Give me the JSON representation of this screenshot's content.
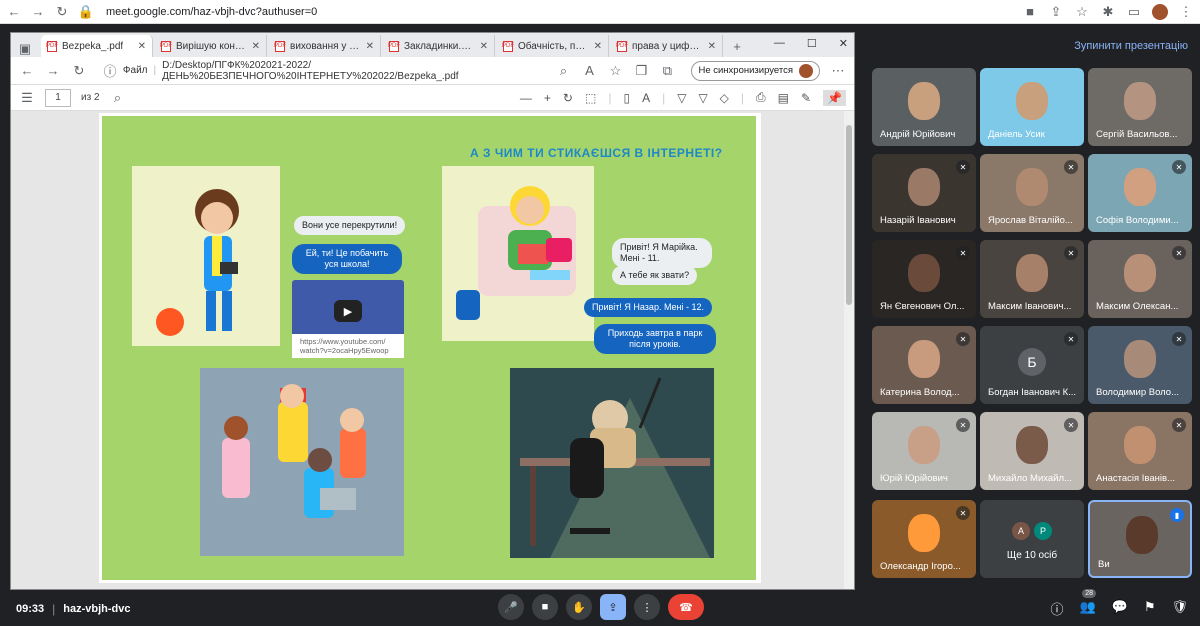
{
  "chrome": {
    "url": "meet.google.com/haz-vbjh-dvc?authuser=0"
  },
  "edge": {
    "tabs": [
      {
        "label": "Bezpeka_.pdf",
        "active": true
      },
      {
        "label": "Вирішую конфлікти \""
      },
      {
        "label": "виховання у цифров"
      },
      {
        "label": "Закладинки.pdf"
      },
      {
        "label": "Обачність, пильністі"
      },
      {
        "label": "права у цифровому"
      }
    ],
    "file_label": "Файл",
    "path": "D:/Desktop/ПГФК%202021-2022/ДЕНЬ%20БЕЗПЕЧНОГО%20ІНТЕРНЕТУ%202022/Bezpeka_.pdf",
    "sync_label": "Не синхронизируется",
    "page_current": "1",
    "page_total": "из 2"
  },
  "slide": {
    "title": "А З ЧИМ ТИ СТИКАЄШСЯ В ІНТЕРНЕТІ?",
    "bubbles": {
      "b1": "Вони усе перекрутили!",
      "b2": "Ей, ти! Це побачить уся школа!",
      "b3": "Привіт! Я Марійка. Мені - 11.",
      "b4": "А тебе як звати?",
      "b5": "Привіт! Я Назар. Мені - 12.",
      "b6": "Приходь завтра в парк після уроків."
    },
    "video_link": "https://www.youtube.com/ watch?v=2ocaHpy5Ewoop"
  },
  "meet": {
    "stop_presenting": "Зупинити презентацію",
    "participants": [
      "Андрій Юрійович",
      "Даніель Усик",
      "Сергій Васильов...",
      "Назарій Іванович",
      "Ярослав Віталійо...",
      "Софія Володими...",
      "Ян Євгенович Ол...",
      "Максим Іванович...",
      "Максим Олексан...",
      "Катерина Волод...",
      "Богдан Іванович К...",
      "Володимир Воло...",
      "Юрій Юрійович",
      "Михайло Михайл...",
      "Анастасія Іванів...",
      "Олександр Ігоро..."
    ],
    "letter_tile": "Б",
    "more_avatars": [
      "А",
      "Р"
    ],
    "more_label": "Ще 10 осіб",
    "self_label": "Ви",
    "meeting_time": "09:33",
    "meeting_code": "haz-vbjh-dvc",
    "people_count": "28"
  }
}
